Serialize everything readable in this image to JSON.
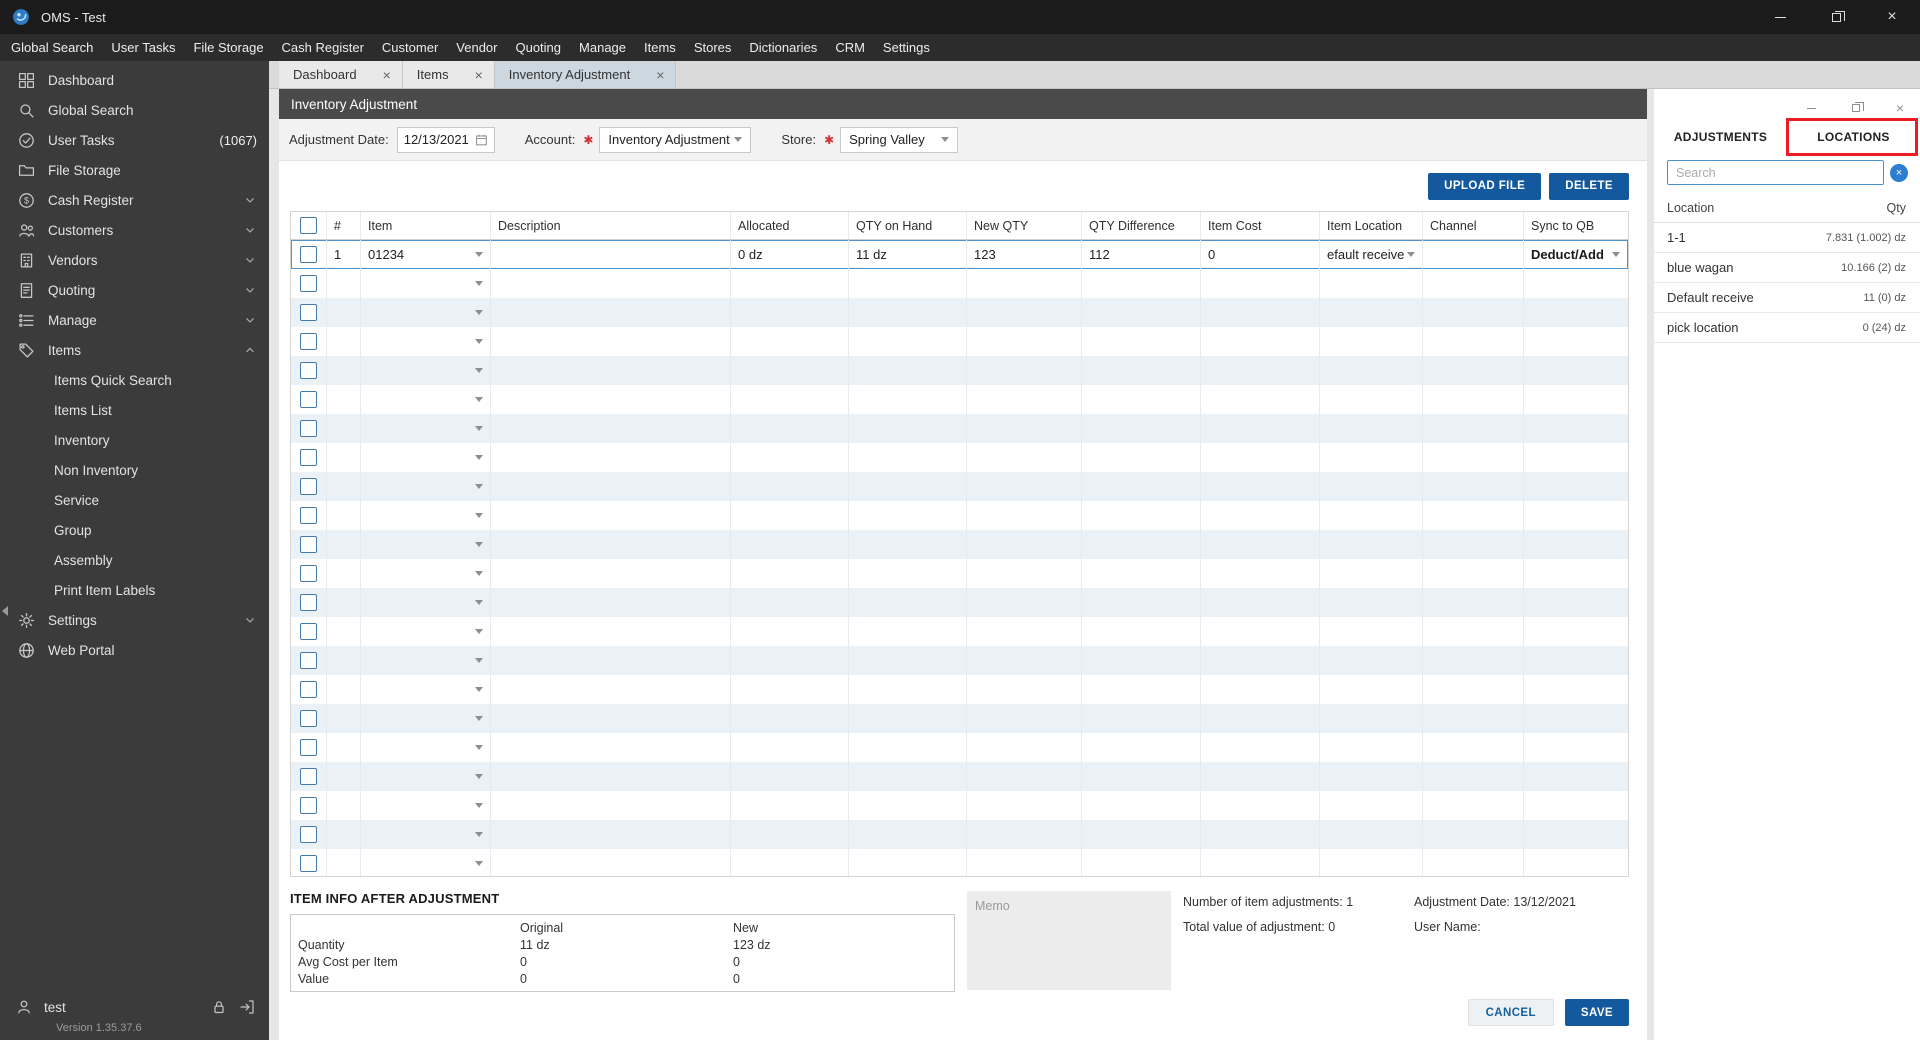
{
  "window": {
    "title": "OMS - Test"
  },
  "menu_bar": {
    "items": [
      "Global Search",
      "User Tasks",
      "File Storage",
      "Cash Register",
      "Customer",
      "Vendor",
      "Quoting",
      "Manage",
      "Items",
      "Stores",
      "Dictionaries",
      "CRM",
      "Settings"
    ]
  },
  "sidebar": {
    "items": [
      {
        "label": "Dashboard",
        "icon": "dashboard"
      },
      {
        "label": "Global Search",
        "icon": "search"
      },
      {
        "label": "User Tasks",
        "icon": "tasks",
        "badge": "(1067)"
      },
      {
        "label": "File Storage",
        "icon": "folder"
      },
      {
        "label": "Cash Register",
        "icon": "cash",
        "chevron": "down"
      },
      {
        "label": "Customers",
        "icon": "customers",
        "chevron": "down"
      },
      {
        "label": "Vendors",
        "icon": "vendors",
        "chevron": "down"
      },
      {
        "label": "Quoting",
        "icon": "quote",
        "chevron": "down"
      },
      {
        "label": "Manage",
        "icon": "manage",
        "chevron": "down"
      },
      {
        "label": "Items",
        "icon": "tag",
        "chevron": "up"
      },
      {
        "label": "Items Quick Search",
        "child": true
      },
      {
        "label": "Items List",
        "child": true
      },
      {
        "label": "Inventory",
        "child": true
      },
      {
        "label": "Non Inventory",
        "child": true
      },
      {
        "label": "Service",
        "child": true
      },
      {
        "label": "Group",
        "child": true
      },
      {
        "label": "Assembly",
        "child": true
      },
      {
        "label": "Print Item Labels",
        "child": true
      },
      {
        "label": "Settings",
        "icon": "gear",
        "chevron": "down"
      },
      {
        "label": "Web Portal",
        "icon": "globe"
      }
    ],
    "user": "test",
    "version": "Version 1.35.37.6"
  },
  "tab_strip": {
    "tabs": [
      {
        "label": "Dashboard",
        "active": false
      },
      {
        "label": "Items",
        "active": false
      },
      {
        "label": "Inventory Adjustment",
        "active": true
      }
    ]
  },
  "page": {
    "title": "Inventory Adjustment",
    "form": {
      "date_label": "Adjustment Date:",
      "date_value": "12/13/2021",
      "account_label": "Account:",
      "account_value": "Inventory Adjustment",
      "store_label": "Store:",
      "store_value": "Spring Valley"
    },
    "toolbar": {
      "upload_label": "UPLOAD FILE",
      "delete_label": "DELETE"
    },
    "table": {
      "columns": [
        "#",
        "Item",
        "Description",
        "Allocated",
        "QTY on Hand",
        "New QTY",
        "QTY Difference",
        "Item Cost",
        "Item Location",
        "Channel",
        "Sync to QB"
      ],
      "rows": [
        {
          "num": "1",
          "item": "01234",
          "description": "",
          "allocated": "0 dz",
          "qty_on_hand": "11 dz",
          "new_qty": "123",
          "qty_difference": "112",
          "item_cost": "0",
          "item_location": "efault receive",
          "channel": "",
          "sync_to_qb": "Deduct/Add"
        }
      ],
      "empty_row_count": 21
    },
    "item_info": {
      "title": "ITEM INFO AFTER ADJUSTMENT",
      "col_original": "Original",
      "col_new": "New",
      "rows": [
        {
          "label": "Quantity",
          "original": "11 dz",
          "new": "123 dz"
        },
        {
          "label": "Avg Cost per Item",
          "original": "0",
          "new": "0"
        },
        {
          "label": "Value",
          "original": "0",
          "new": "0"
        }
      ]
    },
    "memo_placeholder": "Memo",
    "summary": {
      "adjustments_label": "Number of item adjustments:",
      "adjustments_value": "1",
      "total_label": "Total value of adjustment:",
      "total_value": "0",
      "date_label": "Adjustment Date:",
      "date_value": "13/12/2021",
      "user_label": "User Name:"
    },
    "footer": {
      "cancel_label": "CANCEL",
      "save_label": "SAVE"
    }
  },
  "right_panel": {
    "tabs": [
      {
        "label": "ADJUSTMENTS",
        "active": true
      },
      {
        "label": "LOCATIONS",
        "active": false,
        "highlighted": true
      }
    ],
    "search_placeholder": "Search",
    "columns": {
      "location": "Location",
      "qty": "Qty"
    },
    "rows": [
      {
        "location": "1-1",
        "qty": "7.831 (1.002) dz"
      },
      {
        "location": "blue wagan",
        "qty": "10.166 (2) dz"
      },
      {
        "location": "Default receive",
        "qty": "11 (0) dz"
      },
      {
        "location": "pick location",
        "qty": "0 (24) dz"
      }
    ]
  },
  "annotation": {
    "highlight_target": "LOCATIONS",
    "color": "#ed1c24"
  },
  "colors": {
    "accent_blue": "#14599e",
    "selection_blue": "#4d94d0",
    "stripe": "#eaf1f7"
  }
}
